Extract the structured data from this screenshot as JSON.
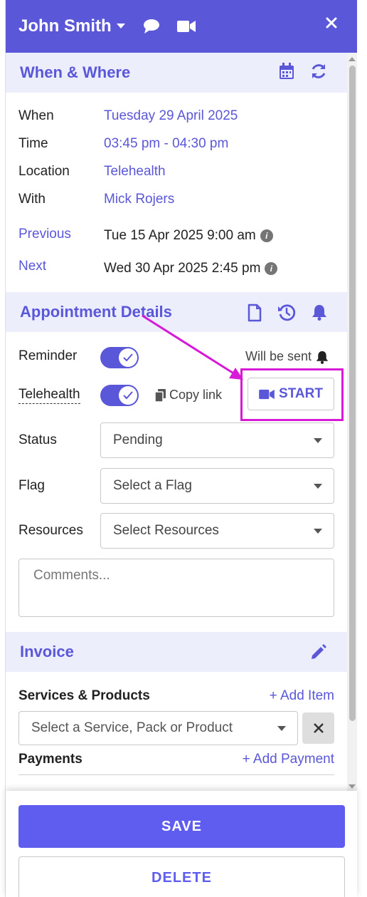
{
  "header": {
    "patient_name": "John Smith"
  },
  "when_where": {
    "title": "When & Where",
    "when_label": "When",
    "when_value": "Tuesday 29 April 2025",
    "time_label": "Time",
    "time_value": "03:45 pm - 04:30 pm",
    "location_label": "Location",
    "location_value": "Telehealth",
    "with_label": "With",
    "with_value": "Mick Rojers",
    "previous_label": "Previous",
    "previous_value": "Tue 15 Apr 2025 9:00 am",
    "next_label": "Next",
    "next_value": "Wed 30 Apr 2025 2:45 pm"
  },
  "appointment": {
    "title": "Appointment Details",
    "reminder_label": "Reminder",
    "reminder_status": "Will be sent",
    "telehealth_label": "Telehealth",
    "copy_link_label": "Copy link",
    "start_label": "START",
    "status_label": "Status",
    "status_value": "Pending",
    "flag_label": "Flag",
    "flag_placeholder": "Select a Flag",
    "resources_label": "Resources",
    "resources_placeholder": "Select Resources",
    "comments_placeholder": "Comments..."
  },
  "invoice": {
    "title": "Invoice",
    "services_label": "Services & Products",
    "add_item_label": "+ Add Item",
    "service_placeholder": "Select a Service, Pack or Product",
    "payments_label": "Payments",
    "add_payment_label": "+ Add Payment"
  },
  "footer": {
    "save_label": "SAVE",
    "delete_label": "DELETE"
  },
  "colors": {
    "brand": "#5b57d9",
    "highlight": "#d61ad6"
  }
}
